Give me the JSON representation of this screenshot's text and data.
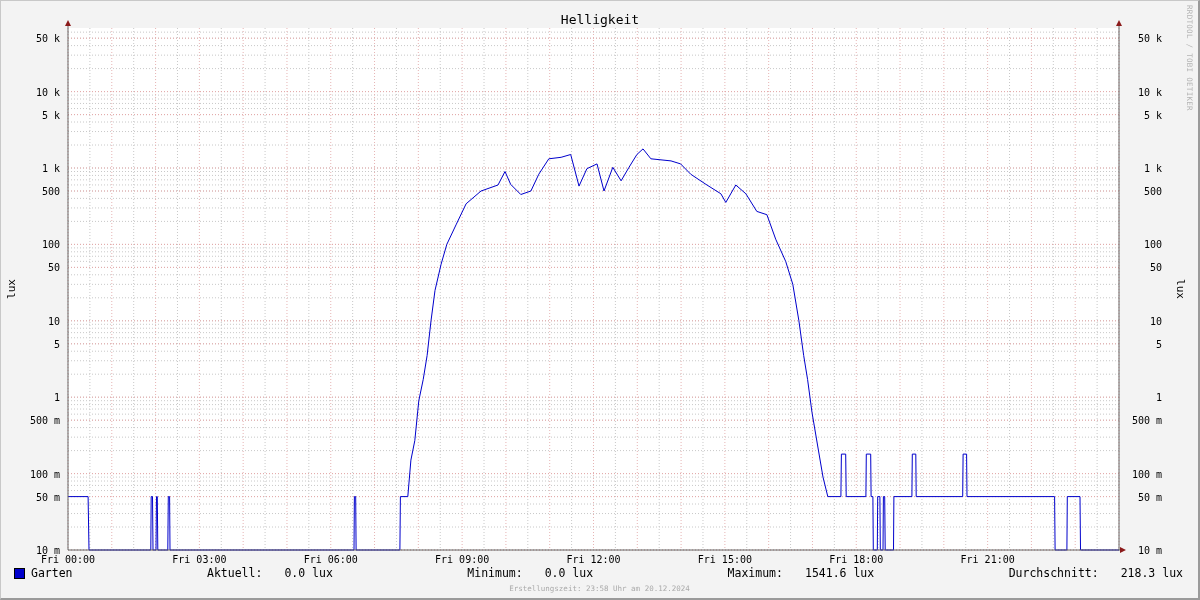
{
  "chart": {
    "title": "Helligkeit",
    "watermark": "RRDTOOL / TOBI OETIKER",
    "left_y_labels": [
      "50 k",
      "10 k",
      "5 k",
      "1 k",
      "500",
      "100",
      "50",
      "10",
      "5",
      "1",
      "500 m",
      "100 m",
      "50 m",
      "10 m"
    ],
    "right_y_labels": [
      "50 k",
      "10 k",
      "5 k",
      "1 k",
      "500",
      "100",
      "50",
      "10",
      "5",
      "1",
      "500 m",
      "100 m",
      "50 m",
      "10 m"
    ],
    "x_labels": [
      "Fri 00:00",
      "Fri 03:00",
      "Fri 06:00",
      "Fri 09:00",
      "Fri 12:00",
      "Fri 15:00",
      "Fri 18:00",
      "Fri 21:00"
    ],
    "left_axis_title": "lux",
    "right_axis_title": "lux"
  },
  "legend": {
    "label": "Garten",
    "color": "#0000cc",
    "stats": [
      {
        "label": "Aktuell:",
        "value": "0.0 lux"
      },
      {
        "label": "Minimum:",
        "value": "0.0 lux"
      },
      {
        "label": "Maximum:",
        "value": "1541.6 lux"
      },
      {
        "label": "Durchschnitt:",
        "value": "218.3 lux"
      }
    ]
  },
  "footer": "Erstellungszeit: 23:58 Uhr am 20.12.2024"
}
